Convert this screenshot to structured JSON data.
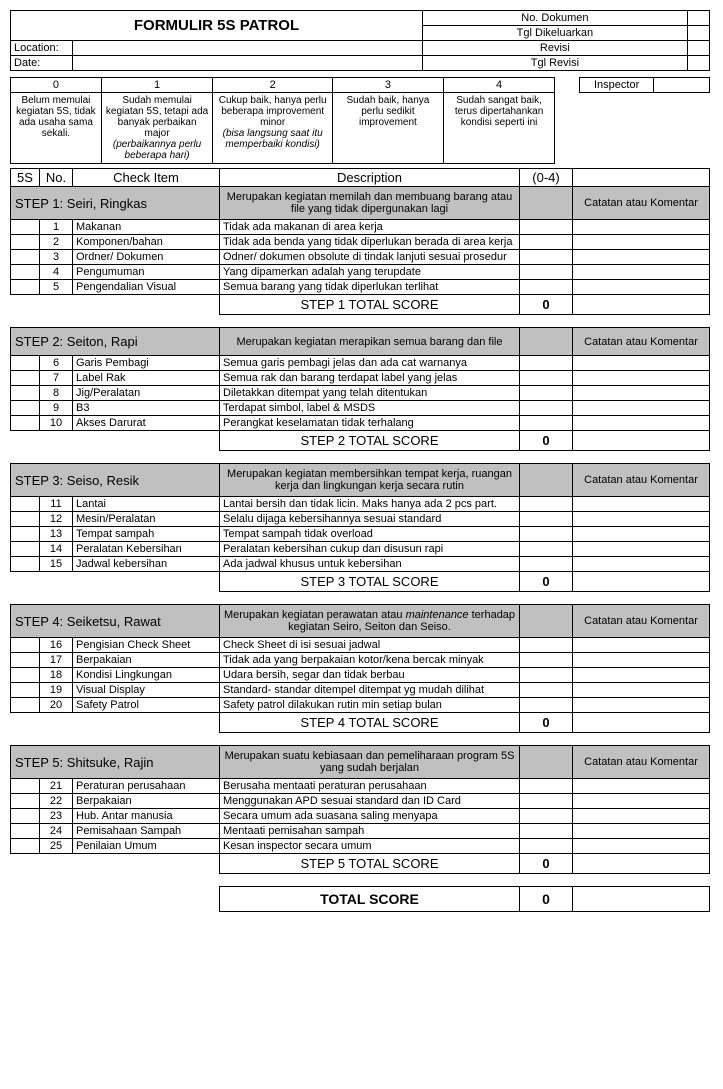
{
  "header": {
    "title": "FORMULIR 5S PATROL",
    "no_dokumen": "No. Dokumen",
    "tgl_dikeluarkan": "Tgl Dikeluarkan",
    "revisi": "Revisi",
    "tgl_revisi": "Tgl Revisi",
    "location_label": "Location:",
    "date_label": "Date:",
    "location_value": "",
    "date_value": ""
  },
  "scale": {
    "labels": [
      "0",
      "1",
      "2",
      "3",
      "4"
    ],
    "desc": [
      "Belum memulai kegiatan 5S, tidak ada usaha sama sekali.",
      "Sudah memulai kegiatan 5S, tetapi ada banyak perbaikan major",
      "Cukup baik, hanya perlu beberapa improvement minor",
      "Sudah baik, hanya perlu sedikit improvement",
      "Sudah sangat baik, terus dipertahankan kondisi seperti ini"
    ],
    "desc_italic": [
      "",
      "(perbaikannya perlu beberapa hari)",
      "(bisa langsung saat itu memperbaiki kondisi)",
      "",
      ""
    ],
    "inspector_label": "Inspector"
  },
  "columns": {
    "ss": "5S",
    "no": "No.",
    "item": "Check Item",
    "desc": "Description",
    "score": "(0-4)"
  },
  "steps": [
    {
      "title": "STEP 1: Seiri, Ringkas",
      "desc": "Merupakan kegiatan memilah dan membuang barang atau file yang tidak dipergunakan lagi",
      "comment_label": "Catatan atau Komentar",
      "rows": [
        {
          "no": "1",
          "item": "Makanan",
          "desc": "Tidak ada makanan di area kerja"
        },
        {
          "no": "2",
          "item": "Komponen/bahan",
          "desc": "Tidak ada benda yang tidak diperlukan berada di area kerja"
        },
        {
          "no": "3",
          "item": "Ordner/ Dokumen",
          "desc": "Odner/ dokumen obsolute di tindak lanjuti sesuai prosedur"
        },
        {
          "no": "4",
          "item": "Pengumuman",
          "desc": "Yang dipamerkan adalah yang terupdate"
        },
        {
          "no": "5",
          "item": "Pengendalian Visual",
          "desc": "Semua barang yang tidak diperlukan terlihat"
        }
      ],
      "total_label": "STEP 1 TOTAL SCORE",
      "total_value": "0"
    },
    {
      "title": "STEP 2: Seiton, Rapi",
      "desc": "Merupakan kegiatan merapikan semua barang dan file",
      "comment_label": "Catatan atau Komentar",
      "rows": [
        {
          "no": "6",
          "item": "Garis Pembagi",
          "desc": "Semua garis pembagi jelas dan ada cat warnanya"
        },
        {
          "no": "7",
          "item": "Label Rak",
          "desc": "Semua rak dan barang terdapat label yang jelas"
        },
        {
          "no": "8",
          "item": "Jig/Peralatan",
          "desc": "Diletakkan ditempat yang telah ditentukan"
        },
        {
          "no": "9",
          "item": "B3",
          "desc": "Terdapat simbol, label & MSDS"
        },
        {
          "no": "10",
          "item": "Akses Darurat",
          "desc": "Perangkat keselamatan tidak terhalang"
        }
      ],
      "total_label": "STEP 2 TOTAL SCORE",
      "total_value": "0"
    },
    {
      "title": "STEP 3: Seiso, Resik",
      "desc": "Merupakan kegiatan membersihkan tempat kerja, ruangan kerja dan lingkungan kerja secara rutin",
      "comment_label": "Catatan atau Komentar",
      "rows": [
        {
          "no": "11",
          "item": "Lantai",
          "desc": "Lantai bersih dan tidak licin. Maks hanya ada 2 pcs part."
        },
        {
          "no": "12",
          "item": "Mesin/Peralatan",
          "desc": "Selalu dijaga kebersihannya sesuai standard"
        },
        {
          "no": "13",
          "item": "Tempat sampah",
          "desc": "Tempat sampah tidak overload"
        },
        {
          "no": "14",
          "item": "Peralatan Kebersihan",
          "desc": "Peralatan kebersihan cukup dan disusun rapi"
        },
        {
          "no": "15",
          "item": "Jadwal kebersihan",
          "desc": "Ada jadwal khusus untuk kebersihan"
        }
      ],
      "total_label": "STEP 3 TOTAL SCORE",
      "total_value": "0"
    },
    {
      "title": "STEP 4: Seiketsu, Rawat",
      "desc_pre": "Merupakan kegiatan perawatan atau ",
      "desc_em": "maintenance",
      "desc_post": " terhadap kegiatan Seiro, Seiton dan Seiso.",
      "comment_label": "Catatan atau Komentar",
      "rows": [
        {
          "no": "16",
          "item": "Pengisian Check Sheet",
          "desc": "Check Sheet di isi sesuai jadwal"
        },
        {
          "no": "17",
          "item": "Berpakaian",
          "desc": "Tidak ada yang berpakaian kotor/kena bercak minyak"
        },
        {
          "no": "18",
          "item": "Kondisi Lingkungan",
          "desc": "Udara bersih, segar dan tidak berbau"
        },
        {
          "no": "19",
          "item": "Visual Display",
          "desc": "Standard- standar ditempel ditempat yg mudah dilihat"
        },
        {
          "no": "20",
          "item": "Safety Patrol",
          "desc": "Safety patrol dilakukan rutin min setiap bulan"
        }
      ],
      "total_label": "STEP 4 TOTAL SCORE",
      "total_value": "0"
    },
    {
      "title": "STEP 5: Shitsuke, Rajin",
      "desc": "Merupakan suatu kebiasaan dan pemeliharaan program 5S yang sudah berjalan",
      "comment_label": "Catatan atau Komentar",
      "rows": [
        {
          "no": "21",
          "item": "Peraturan perusahaan",
          "desc": "Berusaha mentaati peraturan perusahaan"
        },
        {
          "no": "22",
          "item": "Berpakaian",
          "desc": "Menggunakan APD sesuai standard dan ID Card"
        },
        {
          "no": "23",
          "item": "Hub. Antar manusia",
          "desc": "Secara umum ada suasana saling menyapa"
        },
        {
          "no": "24",
          "item": "Pemisahaan Sampah",
          "desc": "Mentaati pemisahan sampah"
        },
        {
          "no": "25",
          "item": "Penilaian Umum",
          "desc": "Kesan inspector secara umum"
        }
      ],
      "total_label": "STEP 5 TOTAL SCORE",
      "total_value": "0"
    }
  ],
  "grand_total_label": "TOTAL SCORE",
  "grand_total_value": "0"
}
